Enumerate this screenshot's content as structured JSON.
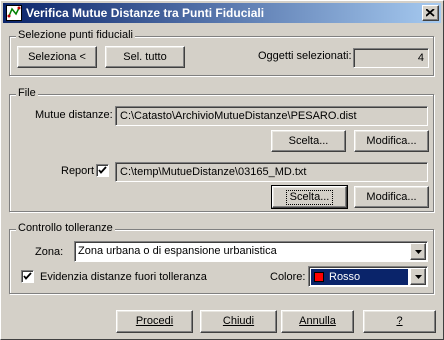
{
  "window": {
    "title": "Verifica Mutue Distanze tra Punti Fiduciali"
  },
  "selection": {
    "legend": "Selezione punti fiduciali",
    "select_label": "Seleziona <",
    "select_all_label": "Sel. tutto",
    "count_label": "Oggetti selezionati:",
    "count_value": "4"
  },
  "file": {
    "legend": "File",
    "distances_label": "Mutue distanze:",
    "distances_path": "C:\\Catasto\\ArchivioMutueDistanze\\PESARO.dist",
    "report_label": "Report",
    "report_checked": true,
    "report_path": "C:\\temp\\MutueDistanze\\03165_MD.txt",
    "choose_label": "Scelta...",
    "modify_label": "Modifica..."
  },
  "tolerance": {
    "legend": "Controllo tolleranze",
    "zone_label": "Zona:",
    "zone_value": "Zona urbana o di espansione urbanistica",
    "highlight_label": "Evidenzia distanze fuori tolleranza",
    "highlight_checked": true,
    "color_label": "Colore:",
    "color_value": "Rosso",
    "color_hex": "#ff0000"
  },
  "footer": {
    "proceed_label": "Procedi",
    "close_label": "Chiudi",
    "cancel_label": "Annulla",
    "help_label": "?"
  }
}
